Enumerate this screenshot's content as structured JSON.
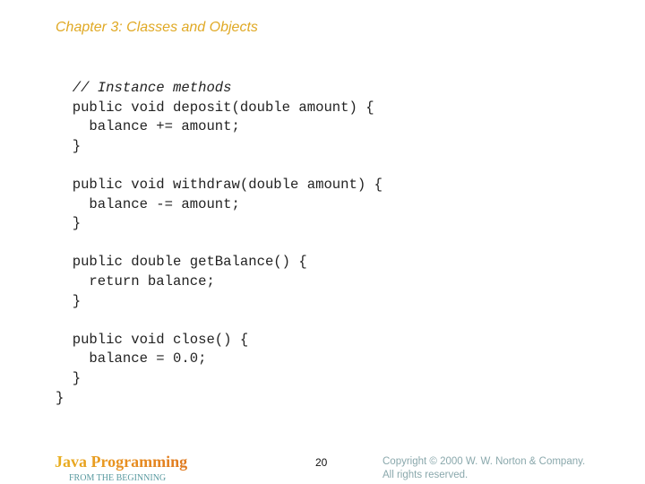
{
  "slide": {
    "title": "Chapter 3: Classes and Objects",
    "code_lines": [
      {
        "text": "  // Instance methods",
        "comment": true
      },
      {
        "text": "  public void deposit(double amount) {",
        "comment": false
      },
      {
        "text": "    balance += amount;",
        "comment": false
      },
      {
        "text": "  }",
        "comment": false
      },
      {
        "text": "",
        "comment": false
      },
      {
        "text": "  public void withdraw(double amount) {",
        "comment": false
      },
      {
        "text": "    balance -= amount;",
        "comment": false
      },
      {
        "text": "  }",
        "comment": false
      },
      {
        "text": "",
        "comment": false
      },
      {
        "text": "  public double getBalance() {",
        "comment": false
      },
      {
        "text": "    return balance;",
        "comment": false
      },
      {
        "text": "  }",
        "comment": false
      },
      {
        "text": "",
        "comment": false
      },
      {
        "text": "  public void close() {",
        "comment": false
      },
      {
        "text": "    balance = 0.0;",
        "comment": false
      },
      {
        "text": "  }",
        "comment": false
      },
      {
        "text": "}",
        "comment": false
      }
    ]
  },
  "footer": {
    "brand": "Java Programming",
    "subtitle": "FROM THE BEGINNING",
    "page_number": "20",
    "copyright_line1": "Copyright © 2000 W. W. Norton & Company.",
    "copyright_line2": "All rights reserved."
  }
}
